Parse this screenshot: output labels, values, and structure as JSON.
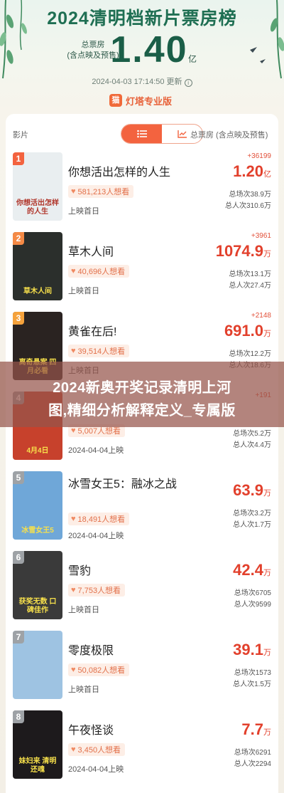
{
  "hero": {
    "title": "2024清明档新片票房榜",
    "total_label_line1": "总票房",
    "total_label_line2": "(含点映及预售)",
    "total_value": "1.40",
    "total_unit": "亿",
    "updated": "2024-04-03 17:14:50 更新",
    "brand_logo": "猫",
    "brand_name": "灯塔专业版"
  },
  "list_header": {
    "film_label": "影片",
    "total_label": "总票房 (含点映及预售)"
  },
  "movies": [
    {
      "rank": "1",
      "title": "你想活出怎样的人生",
      "want": "581,213人想看",
      "release": "上映首日",
      "delta": "+36199",
      "box": "1.20",
      "unit": "亿",
      "sessions": "总场次38.9万",
      "people": "总人次310.6万",
      "poster_text": "你想活出怎样的人生",
      "poster_color": "#e9eef0",
      "rank_color": "#f3633f"
    },
    {
      "rank": "2",
      "title": "草木人间",
      "want": "40,696人想看",
      "release": "上映首日",
      "delta": "+3961",
      "box": "1074.9",
      "unit": "万",
      "sessions": "总场次13.1万",
      "people": "总人次27.4万",
      "poster_text": "草木人间",
      "poster_color": "#2b2f2c",
      "rank_color": "#f58a46"
    },
    {
      "rank": "3",
      "title": "黄雀在后!",
      "want": "39,514人想看",
      "release": "上映首日",
      "delta": "+2148",
      "box": "691.0",
      "unit": "万",
      "sessions": "总场次12.2万",
      "people": "总人次18.6万",
      "poster_text": "离奇悬案 四月必看",
      "poster_color": "#2a2321",
      "rank_color": "#f5a23c"
    },
    {
      "rank": "4",
      "title": "",
      "want": "5,007人想看",
      "release": "2024-04-04上映",
      "delta": "+191",
      "box": "",
      "unit": "",
      "sessions": "总场次5.2万",
      "people": "总人次4.4万",
      "poster_text": "4月4日",
      "poster_color": "#c7412c",
      "rank_color": "#9ea2a6"
    },
    {
      "rank": "5",
      "title": "冰雪女王5：融冰之战",
      "want": "18,491人想看",
      "release": "2024-04-04上映",
      "delta": "",
      "box": "63.9",
      "unit": "万",
      "sessions": "总场次3.2万",
      "people": "总人次1.7万",
      "poster_text": "冰雪女王5",
      "poster_color": "#6fa7d8",
      "rank_color": "#9ea2a6"
    },
    {
      "rank": "6",
      "title": "雪豹",
      "want": "7,753人想看",
      "release": "上映首日",
      "delta": "",
      "box": "42.4",
      "unit": "万",
      "sessions": "总场次6705",
      "people": "总人次9599",
      "poster_text": "获奖无数 口碑佳作",
      "poster_color": "#3a3a3a",
      "rank_color": "#9ea2a6"
    },
    {
      "rank": "7",
      "title": "零度极限",
      "want": "50,082人想看",
      "release": "上映首日",
      "delta": "",
      "box": "39.1",
      "unit": "万",
      "sessions": "总场次1573",
      "people": "总人次1.5万",
      "poster_text": "",
      "poster_color": "#9ec3e2",
      "rank_color": "#9ea2a6"
    },
    {
      "rank": "8",
      "title": "午夜怪谈",
      "want": "3,450人想看",
      "release": "2024-04-04上映",
      "delta": "",
      "box": "7.7",
      "unit": "万",
      "sessions": "总场次6291",
      "people": "总人次2294",
      "poster_text": "妹妇来 清明还魂",
      "poster_color": "#1d1a1c",
      "rank_color": "#9ea2a6"
    }
  ],
  "banner": {
    "line1": "2024新奥开奖记录清明上河",
    "line2": "图,精细分析解释定义_专属版"
  }
}
